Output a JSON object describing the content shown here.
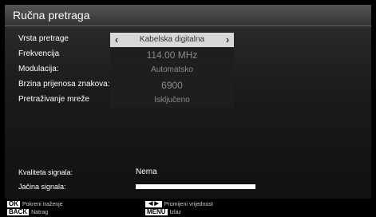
{
  "header": {
    "title": "Ručna pretraga"
  },
  "rows": [
    {
      "label": "Vrsta pretrage",
      "value": "Kabelska digitalna",
      "left_arrow": "‹",
      "right_arrow": "›"
    },
    {
      "label": "Frekvencija",
      "value": "114.00 MHz"
    },
    {
      "label": "Modulacija:",
      "value": "Automatsko"
    },
    {
      "label": "Brzina prijenosa znakova:",
      "value": "6900"
    },
    {
      "label": "Pretraživanje mreže",
      "value": "Isključeno"
    }
  ],
  "signal": {
    "quality_label": "Kvaliteta signala:",
    "quality_value": "Nema",
    "strength_label": "Jačina signala:"
  },
  "footer": {
    "ok_key": "OK",
    "ok_text": "Pokreni traženje",
    "back_key": "BACK",
    "back_text": "Natrag",
    "arrow_key": "◀ ▶",
    "arrow_text": "Promijeni vrijednost",
    "menu_key": "MENU",
    "menu_text": "Izlaz"
  }
}
